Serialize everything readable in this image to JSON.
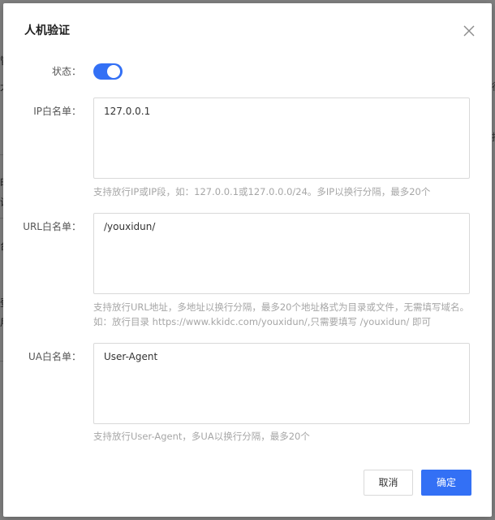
{
  "dialog": {
    "title": "人机验证",
    "close_icon": "close-icon"
  },
  "form": {
    "status": {
      "label": "状态：",
      "enabled": true
    },
    "ip_whitelist": {
      "label": "IP白名单：",
      "value": "127.0.0.1",
      "help": "支持放行IP或IP段，如：127.0.0.1或127.0.0.0/24。多IP以换行分隔，最多20个"
    },
    "url_whitelist": {
      "label": "URL白名单：",
      "value": "/youxidun/",
      "help": "支持放行URL地址，多地址以换行分隔，最多20个地址格式为目录或文件，无需填写域名。如：放行目录 https://www.kkidc.com/youxidun/,只需要填写 /youxidun/ 即可"
    },
    "ua_whitelist": {
      "label": "UA白名单：",
      "value": "User-Agent",
      "help": "支持放行User-Agent，多UA以换行分隔，最多20个"
    }
  },
  "footer": {
    "cancel_label": "取消",
    "ok_label": "确定"
  },
  "colors": {
    "accent": "#3370f5",
    "help_text": "#a6a6a6",
    "border": "#d9d9d9"
  }
}
